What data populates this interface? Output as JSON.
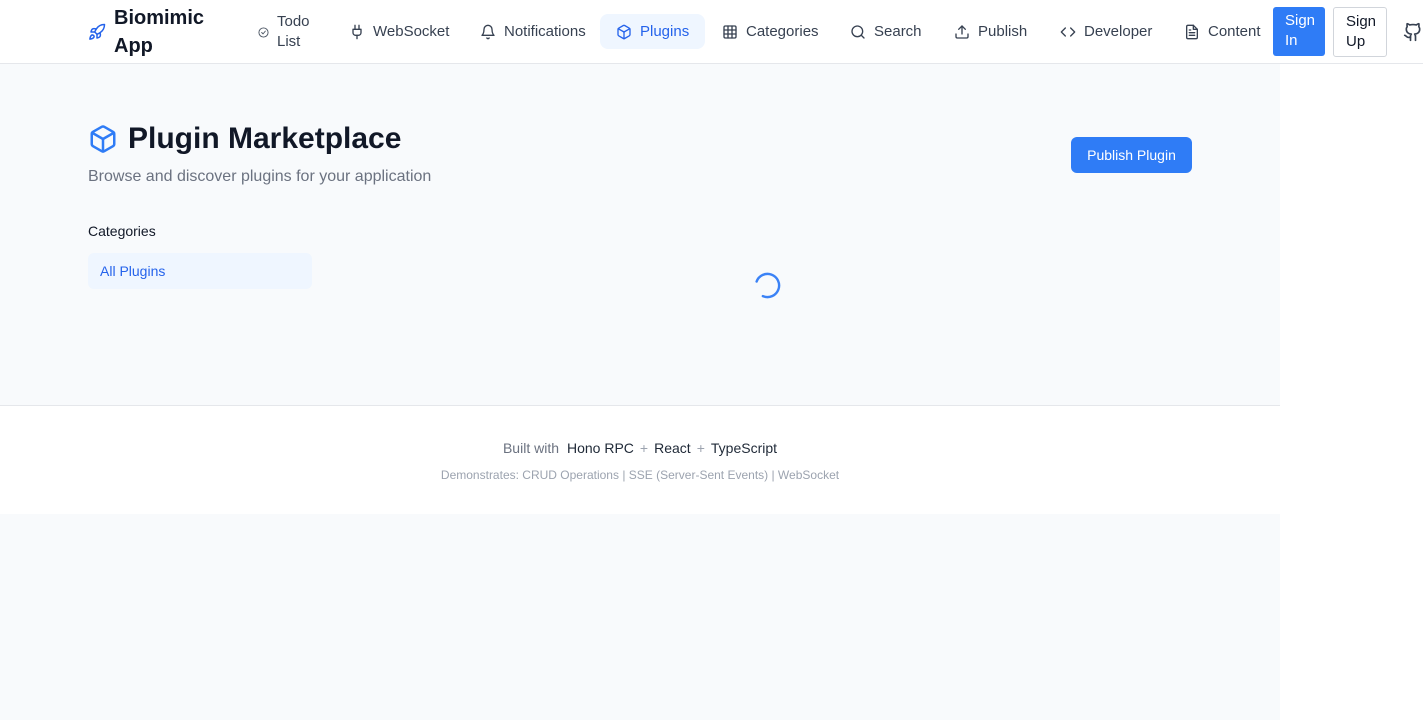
{
  "header": {
    "brand": "Biomimic App",
    "nav": [
      {
        "label": "Todo List",
        "icon": "check-circle-icon"
      },
      {
        "label": "WebSocket",
        "icon": "plug-icon"
      },
      {
        "label": "Notifications",
        "icon": "bell-icon"
      },
      {
        "label": "Plugins",
        "icon": "package-icon",
        "active": true
      },
      {
        "label": "Categories",
        "icon": "grid-icon"
      },
      {
        "label": "Search",
        "icon": "search-icon"
      },
      {
        "label": "Publish",
        "icon": "upload-icon"
      },
      {
        "label": "Developer",
        "icon": "code-icon"
      },
      {
        "label": "Content",
        "icon": "file-text-icon"
      }
    ],
    "sign_in": "Sign In",
    "sign_up": "Sign Up"
  },
  "main": {
    "title": "Plugin Marketplace",
    "subtitle": "Browse and discover plugins for your application",
    "publish_button": "Publish Plugin",
    "categories_heading": "Categories",
    "categories": [
      "All Plugins"
    ]
  },
  "footer": {
    "built_with": "Built with",
    "tech": [
      "Hono RPC",
      "React",
      "TypeScript"
    ],
    "separator": "+",
    "demonstrates": "Demonstrates: CRUD Operations | SSE (Server-Sent Events) | WebSocket"
  },
  "colors": {
    "accent": "#2f7cf6",
    "active_bg": "#eff6ff",
    "active_text": "#2563eb",
    "page_bg": "#f8fafc"
  }
}
